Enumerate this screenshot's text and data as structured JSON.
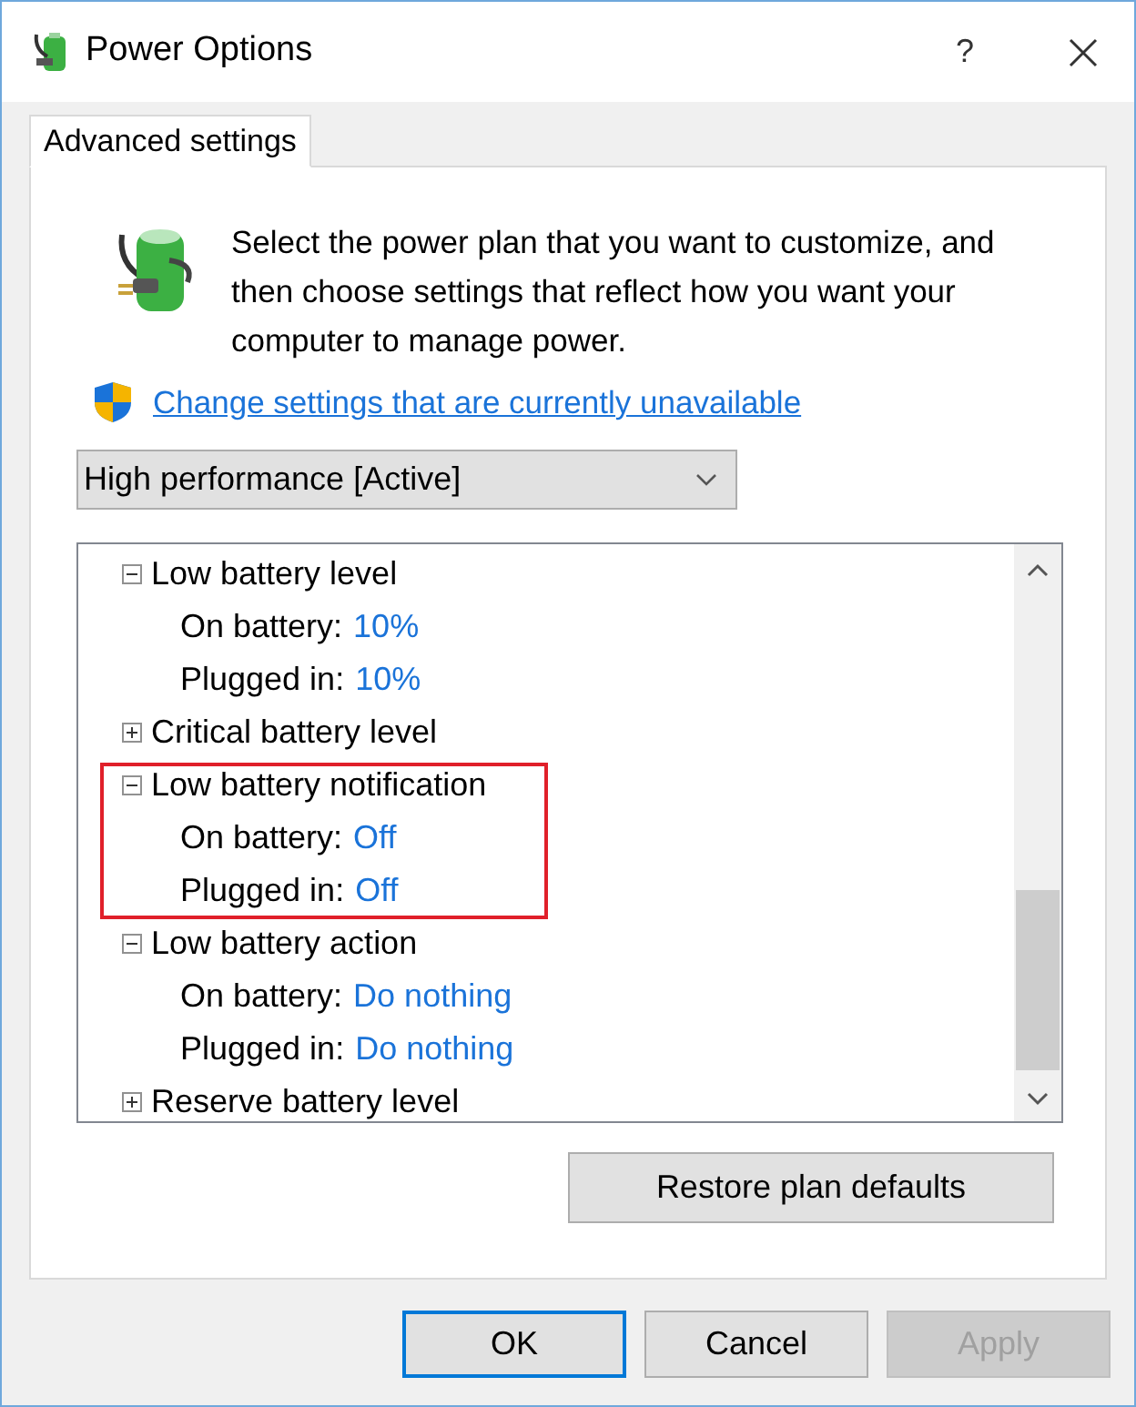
{
  "window": {
    "title": "Power Options",
    "help": "?"
  },
  "tabs": [
    {
      "label": "Advanced settings",
      "selected": true
    }
  ],
  "description": "Select the power plan that you want to customize, and then choose settings that reflect how you want your computer to manage power.",
  "change_link": "Change settings that are currently unavailable",
  "plan_dropdown": {
    "value": "High performance [Active]"
  },
  "settings_tree": [
    {
      "label": "Low battery level",
      "expanded": true,
      "highlighted": false,
      "children": [
        {
          "label": "On battery:",
          "value": "10%"
        },
        {
          "label": "Plugged in:",
          "value": "10%"
        }
      ]
    },
    {
      "label": "Critical battery level",
      "expanded": false,
      "highlighted": false
    },
    {
      "label": "Low battery notification",
      "expanded": true,
      "highlighted": true,
      "children": [
        {
          "label": "On battery:",
          "value": "Off"
        },
        {
          "label": "Plugged in:",
          "value": "Off"
        }
      ]
    },
    {
      "label": "Low battery action",
      "expanded": true,
      "highlighted": false,
      "children": [
        {
          "label": "On battery:",
          "value": "Do nothing"
        },
        {
          "label": "Plugged in:",
          "value": "Do nothing"
        }
      ]
    },
    {
      "label": "Reserve battery level",
      "expanded": false,
      "highlighted": false
    }
  ],
  "restore_button": "Restore plan defaults",
  "buttons": [
    {
      "label": "OK",
      "kind": "default",
      "disabled": false
    },
    {
      "label": "Cancel",
      "kind": "normal",
      "disabled": false
    },
    {
      "label": "Apply",
      "kind": "normal",
      "disabled": true
    }
  ]
}
